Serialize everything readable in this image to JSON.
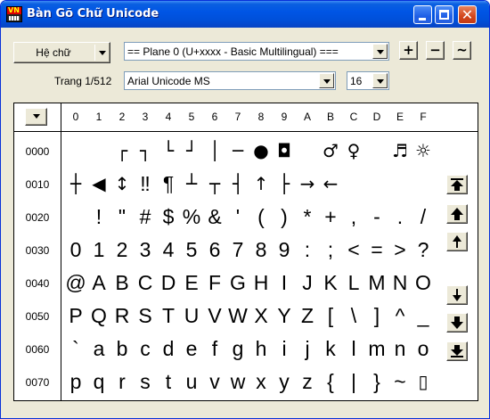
{
  "window": {
    "title": "Bàn Gõ Chữ Unicode"
  },
  "toolbar": {
    "font_button_label": "Hệ chữ",
    "plane_select": "== Plane 0 (U+xxxx - Basic Multilingual) ===",
    "font_select": "Arial Unicode MS",
    "size_select": "16",
    "page_label": "Trang 1/512",
    "plus_label": "+",
    "minus_label": "−",
    "tilde_label": "~"
  },
  "grid": {
    "columns": [
      "0",
      "1",
      "2",
      "3",
      "4",
      "5",
      "6",
      "7",
      "8",
      "9",
      "A",
      "B",
      "C",
      "D",
      "E",
      "F"
    ],
    "rows": [
      {
        "label": "0000",
        "chars": [
          "",
          "",
          "┌",
          "┐",
          "└",
          "┘",
          "│",
          "─",
          "●",
          "◘",
          "",
          "♂",
          "♀",
          "",
          "♬",
          "☼"
        ]
      },
      {
        "label": "0010",
        "chars": [
          "┼",
          "◀",
          "↕",
          "‼",
          "¶",
          "┴",
          "┬",
          "┤",
          "↑",
          "├",
          "→",
          "←",
          "",
          "",
          "",
          ""
        ]
      },
      {
        "label": "0020",
        "chars": [
          "",
          "!",
          "\"",
          "#",
          "$",
          "%",
          "&",
          "'",
          "(",
          ")",
          "*",
          "+",
          ",",
          "-",
          ".",
          "/"
        ]
      },
      {
        "label": "0030",
        "chars": [
          "0",
          "1",
          "2",
          "3",
          "4",
          "5",
          "6",
          "7",
          "8",
          "9",
          ":",
          ";",
          "<",
          "=",
          ">",
          "?"
        ]
      },
      {
        "label": "0040",
        "chars": [
          "@",
          "A",
          "B",
          "C",
          "D",
          "E",
          "F",
          "G",
          "H",
          "I",
          "J",
          "K",
          "L",
          "M",
          "N",
          "O"
        ]
      },
      {
        "label": "0050",
        "chars": [
          "P",
          "Q",
          "R",
          "S",
          "T",
          "U",
          "V",
          "W",
          "X",
          "Y",
          "Z",
          "[",
          "\\",
          "]",
          "^",
          "_"
        ]
      },
      {
        "label": "0060",
        "chars": [
          "`",
          "a",
          "b",
          "c",
          "d",
          "e",
          "f",
          "g",
          "h",
          "i",
          "j",
          "k",
          "l",
          "m",
          "n",
          "o"
        ]
      },
      {
        "label": "0070",
        "chars": [
          "p",
          "q",
          "r",
          "s",
          "t",
          "u",
          "v",
          "w",
          "x",
          "y",
          "z",
          "{",
          "|",
          "}",
          "~",
          "▯"
        ]
      }
    ]
  },
  "icons": {
    "app": "app-icon",
    "scroll": [
      "scroll-to-top-icon",
      "page-up-icon",
      "line-up-icon",
      "line-down-icon",
      "page-down-icon",
      "scroll-to-bottom-icon"
    ]
  },
  "colors": {
    "title_bar": "#0055e5",
    "window_bg": "#ece9d8",
    "grid_bg": "#ffffff"
  }
}
